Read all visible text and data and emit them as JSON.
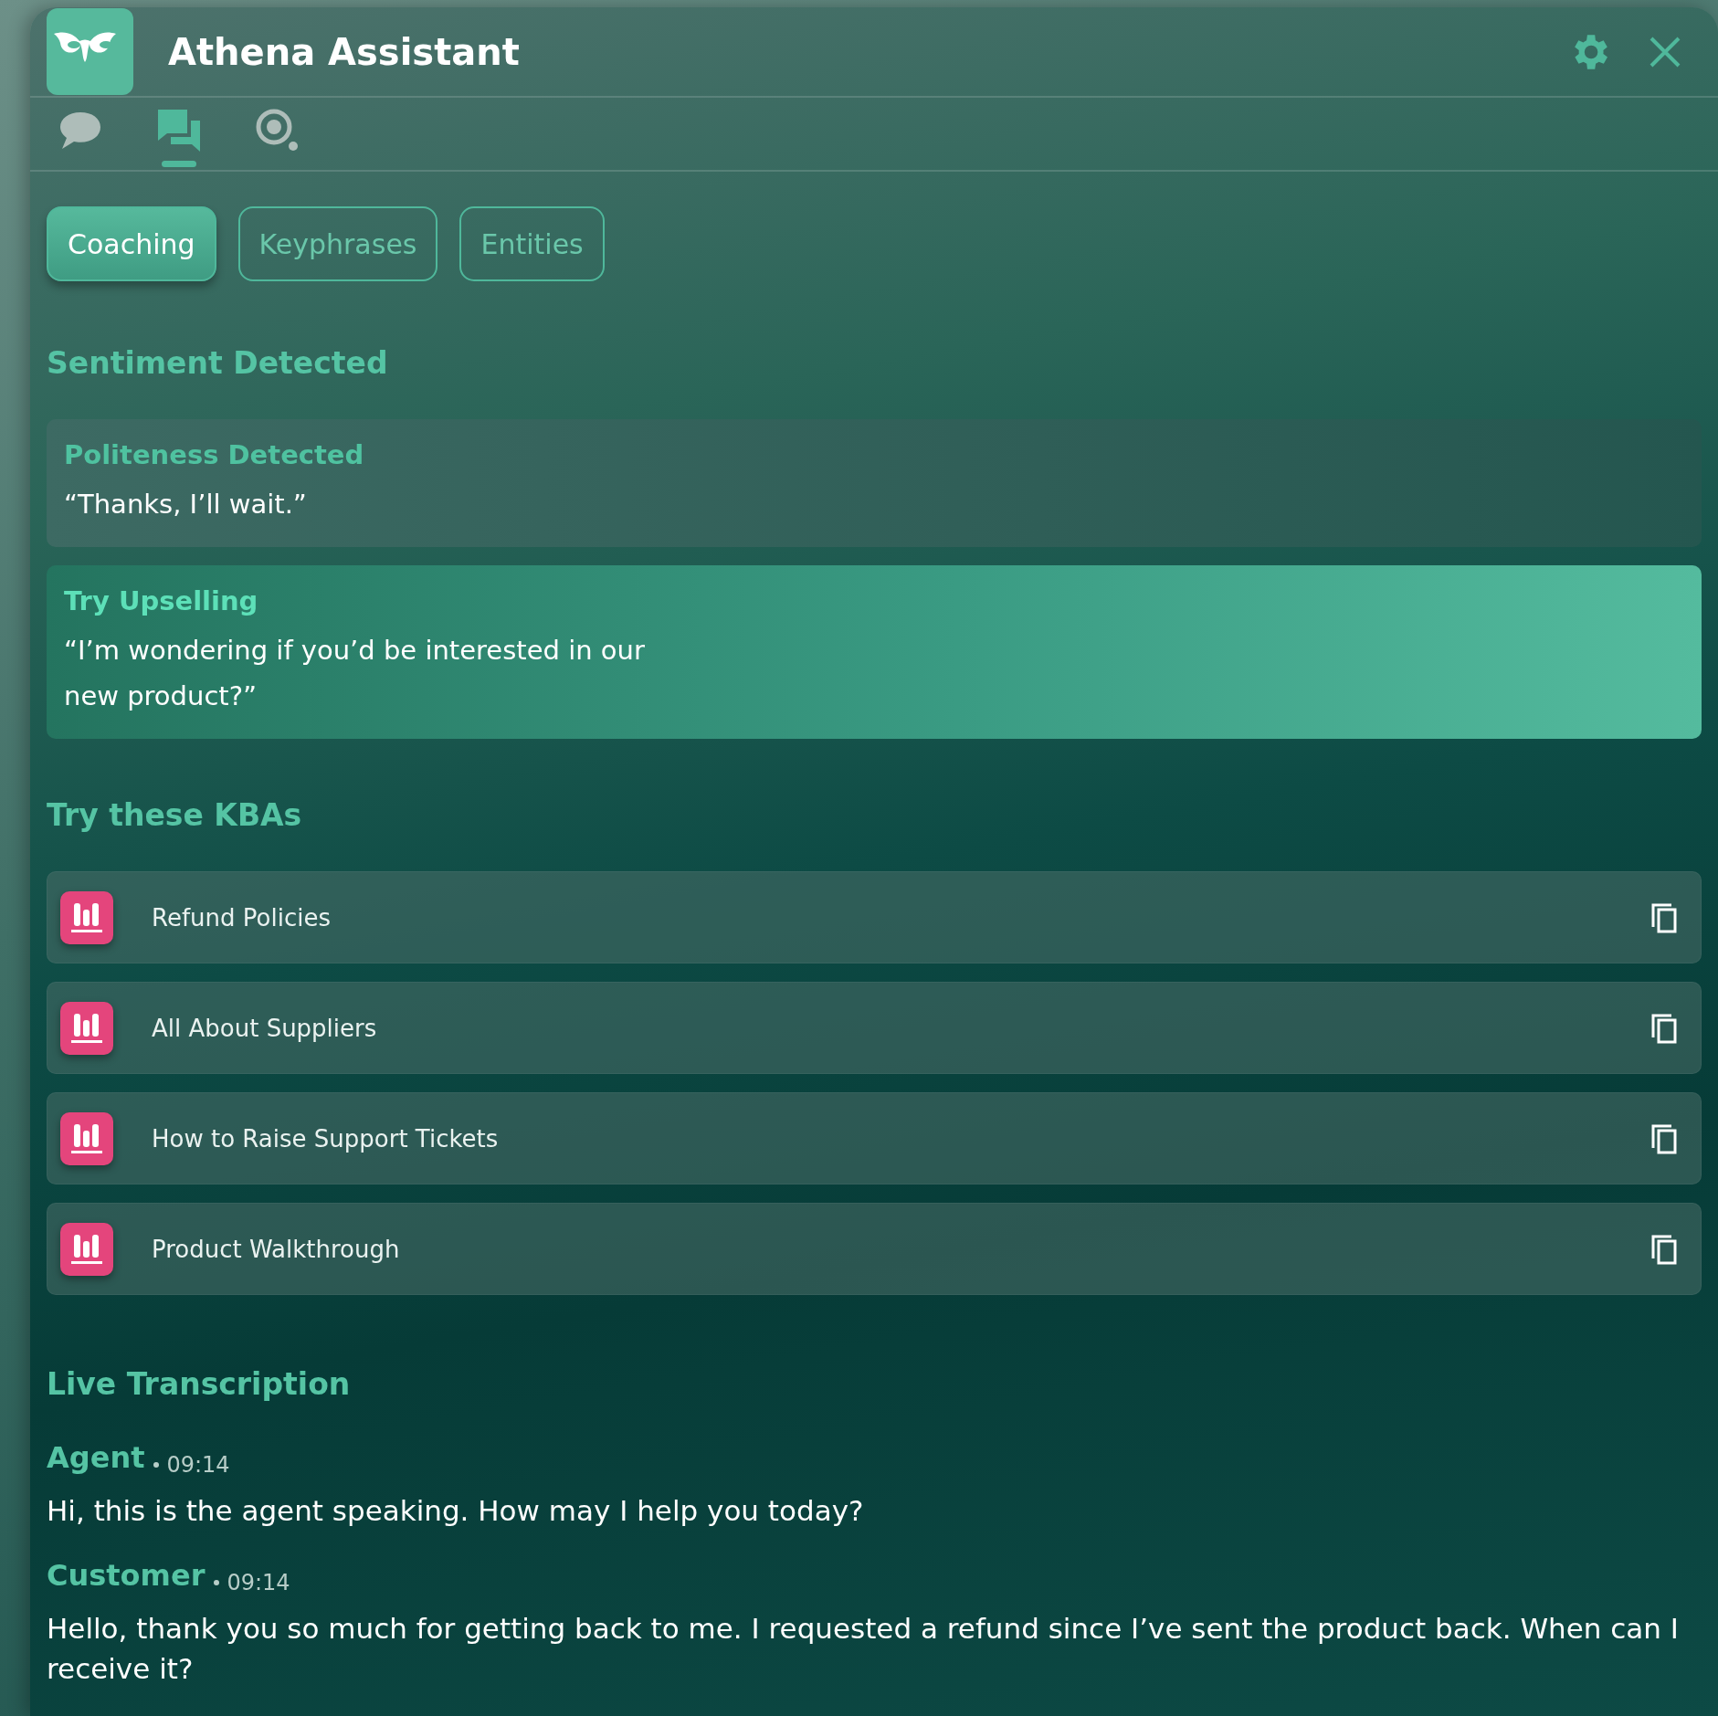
{
  "window": {
    "title": "Athena Assistant"
  },
  "views": [
    {
      "kind": "chat",
      "selected": false
    },
    {
      "kind": "conversation",
      "selected": true
    },
    {
      "kind": "target",
      "selected": false
    }
  ],
  "tabs": [
    {
      "label": "Coaching",
      "selected": true
    },
    {
      "label": "Keyphrases",
      "selected": false
    },
    {
      "label": "Entities",
      "selected": false
    }
  ],
  "sentiment": {
    "heading": "Sentiment Detected",
    "cards": [
      {
        "title": "Politeness Detected",
        "quote": "“Thanks, I’ll wait.”",
        "highlighted": false
      },
      {
        "title": "Try Upselling",
        "quote": "“I’m wondering if you’d be interested in our new product?”",
        "highlighted": true
      }
    ]
  },
  "kbas": {
    "heading": "Try these KBAs",
    "items": [
      {
        "label": "Refund Policies"
      },
      {
        "label": "All About Suppliers"
      },
      {
        "label": "How to Raise Support Tickets"
      },
      {
        "label": "Product Walkthrough"
      }
    ]
  },
  "transcription": {
    "heading": "Live Transcription",
    "messages": [
      {
        "speaker": "Agent",
        "time": "09:14",
        "text": "Hi, this is the agent speaking. How may I help you today?"
      },
      {
        "speaker": "Customer",
        "time": "09:14",
        "text": "Hello, thank you so much for getting back to me. I requested a refund since I’ve sent the product back. When can I receive it?"
      }
    ]
  }
}
